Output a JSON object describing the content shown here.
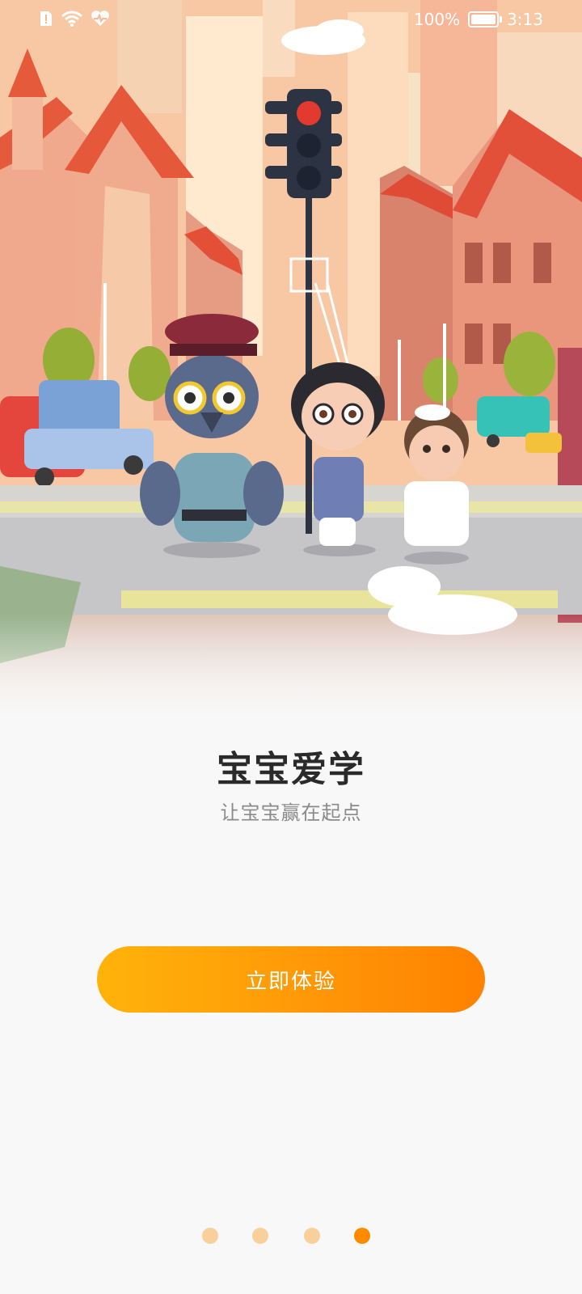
{
  "status_bar": {
    "battery_level": "100%",
    "time": "3:13",
    "icons": [
      "sim-alert-icon",
      "wifi-icon",
      "heart-rate-icon",
      "battery-icon"
    ]
  },
  "hero": {
    "image_name": "city-crosswalk-illustration"
  },
  "page": {
    "title": "宝宝爱学",
    "subtitle": "让宝宝赢在起点"
  },
  "cta": {
    "label": "立即体验",
    "colors": [
      "#ffb30a",
      "#ff8100"
    ]
  },
  "pager": {
    "count": 4,
    "active_index": 3,
    "active_color": "#ff8a00",
    "inactive_color": "#f9cf9b"
  }
}
